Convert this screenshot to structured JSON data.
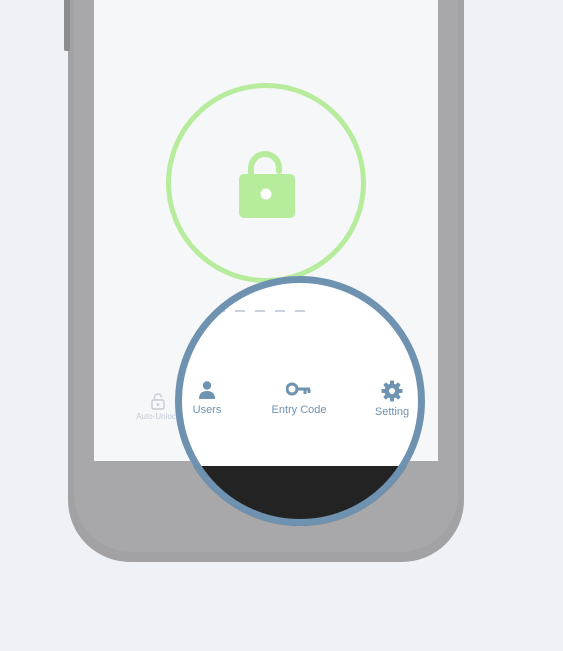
{
  "colors": {
    "background": "#eef2f6",
    "phone": "#a2a2a4",
    "screen": "#f5f7f9",
    "unlock_green": "#b6ec9c",
    "accent_blue": "#6e92b0",
    "dark_bezel": "#232323"
  },
  "status_icon": "unlocked-padlock-icon",
  "tab_bar": {
    "items": [
      {
        "label": "Auto-Unlock",
        "icon": "padlock-icon"
      },
      {
        "label": "Users",
        "icon": "user-icon"
      },
      {
        "label": "Entry Code",
        "icon": "key-icon"
      },
      {
        "label": "Setting",
        "icon": "gear-icon"
      }
    ]
  }
}
